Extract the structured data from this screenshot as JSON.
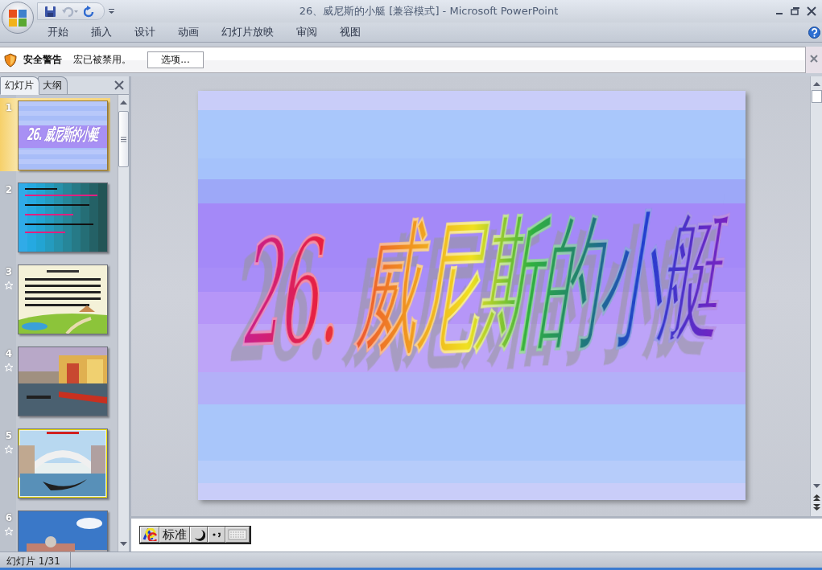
{
  "window": {
    "title": "26、威尼斯的小艇 [兼容模式] - Microsoft PowerPoint"
  },
  "ribbon_tabs": [
    {
      "label": "开始",
      "selected": false
    },
    {
      "label": "插入",
      "selected": false
    },
    {
      "label": "设计",
      "selected": false
    },
    {
      "label": "动画",
      "selected": false
    },
    {
      "label": "幻灯片放映",
      "selected": false
    },
    {
      "label": "审阅",
      "selected": false
    },
    {
      "label": "视图",
      "selected": false
    }
  ],
  "security_bar": {
    "title": "安全警告",
    "message": "宏已被禁用。",
    "button": "选项..."
  },
  "panel_tabs": [
    {
      "label": "幻灯片",
      "selected": true
    },
    {
      "label": "大纲",
      "selected": false
    }
  ],
  "slides": [
    {
      "number": "1",
      "selected": true,
      "animated": false,
      "kind": "title",
      "title": "26. 威尼斯的小艇"
    },
    {
      "number": "2",
      "selected": false,
      "animated": false,
      "kind": "text"
    },
    {
      "number": "3",
      "selected": false,
      "animated": true,
      "kind": "meadow"
    },
    {
      "number": "4",
      "selected": false,
      "animated": true,
      "kind": "canal"
    },
    {
      "number": "5",
      "selected": false,
      "animated": true,
      "kind": "bridge"
    },
    {
      "number": "6",
      "selected": false,
      "animated": true,
      "kind": "sea"
    }
  ],
  "slide": {
    "title": "26. 威尼斯的小艇"
  },
  "ime_bar": {
    "mode": "标准"
  },
  "status_bar": {
    "slide_counter": "幻灯片 1/31"
  }
}
